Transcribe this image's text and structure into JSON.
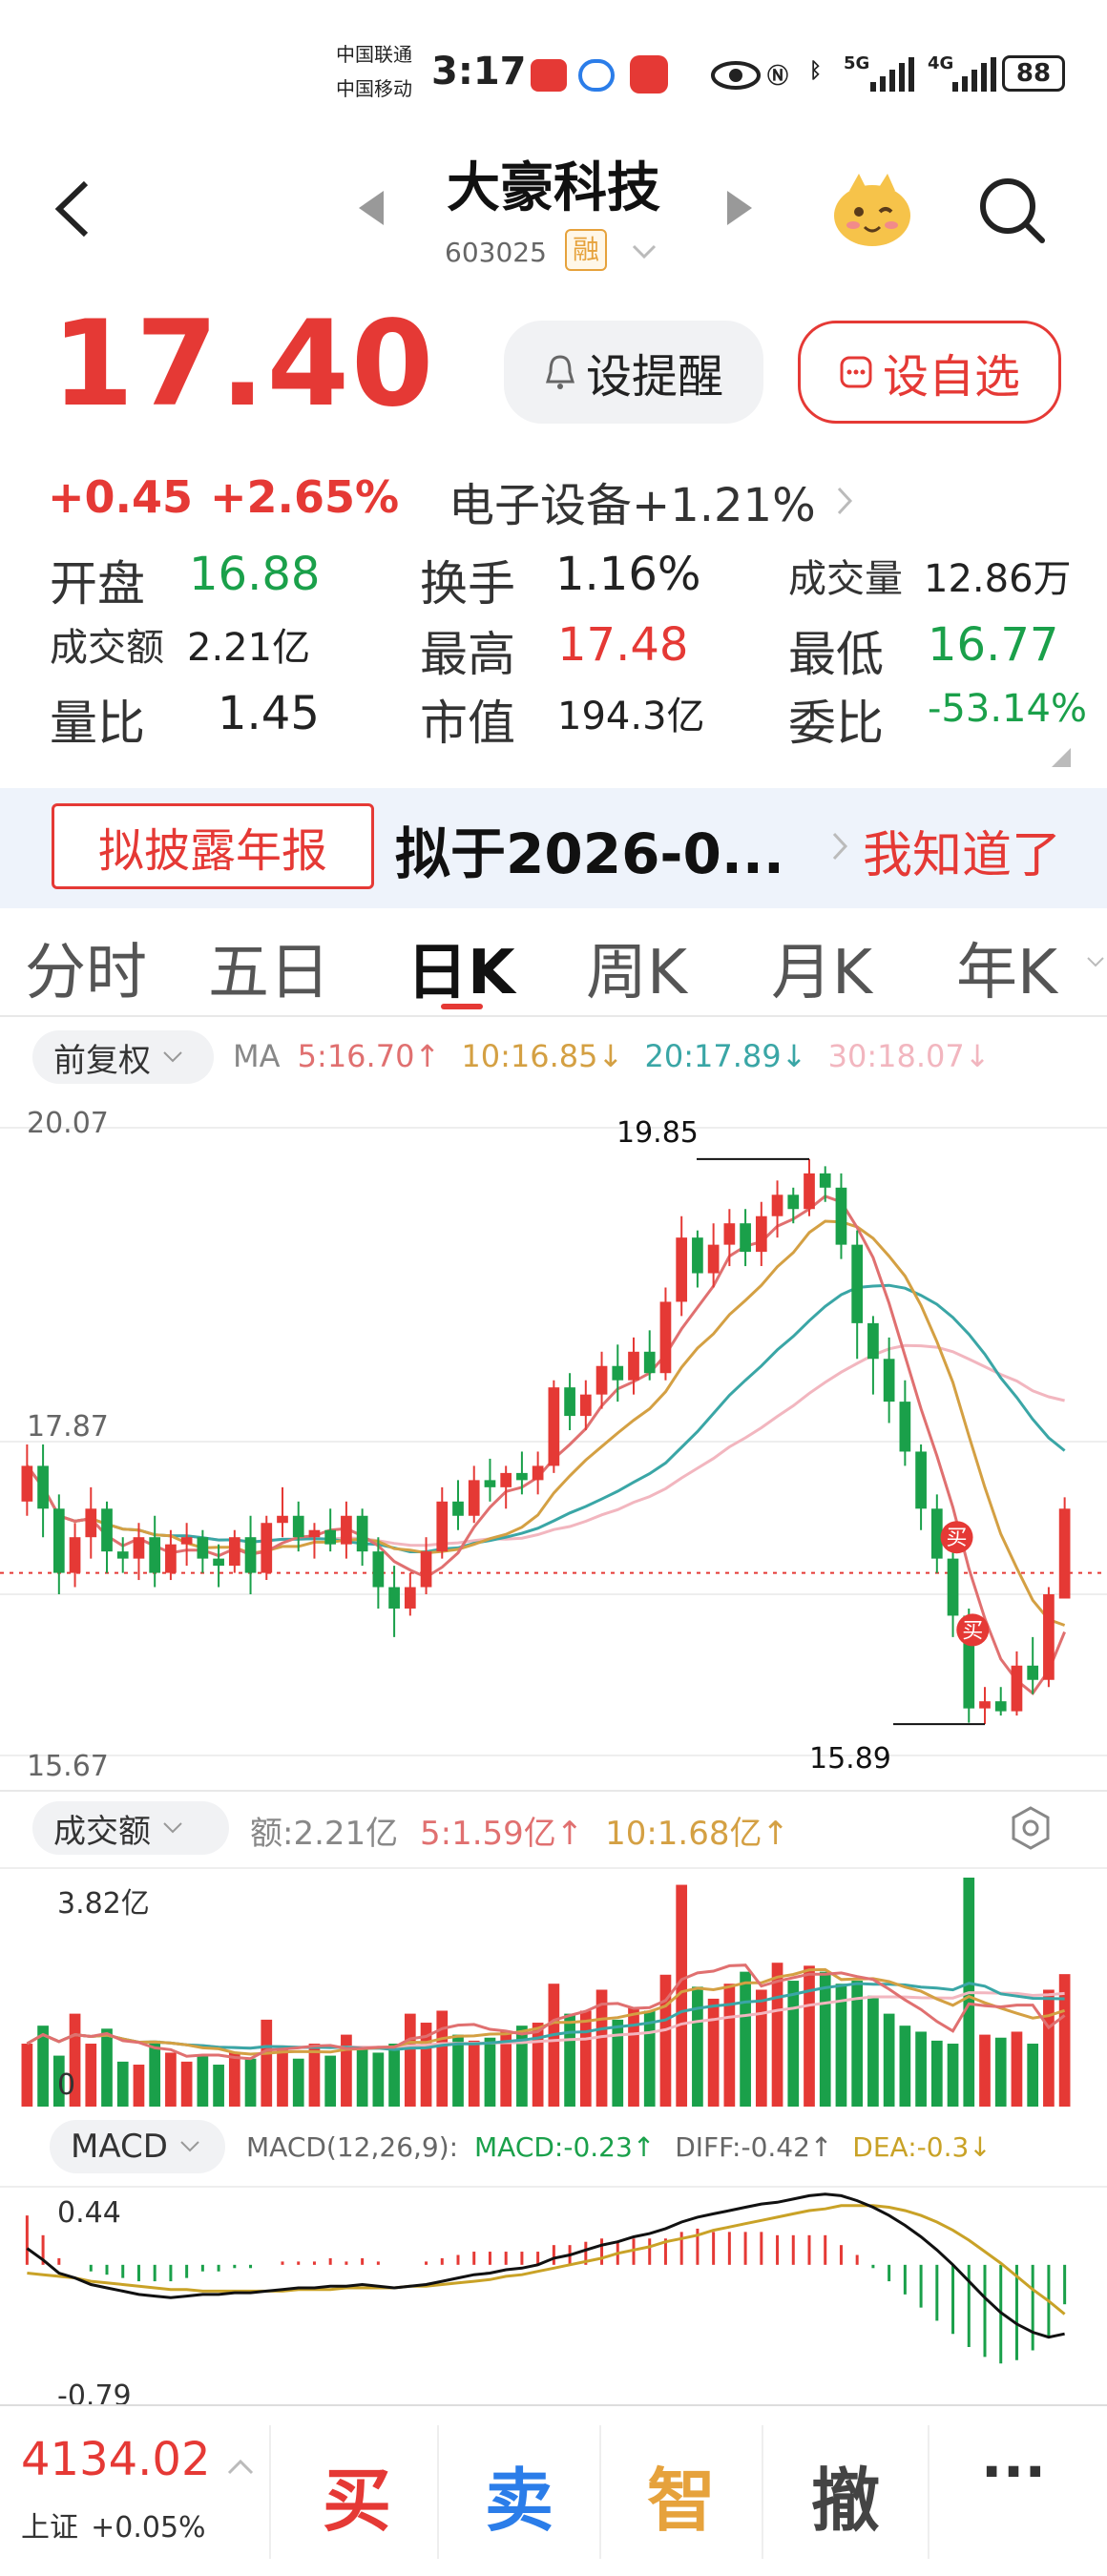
{
  "status_bar": {
    "carrier1": "中国联通",
    "carrier2": "中国移动",
    "time": "3:17",
    "network1": "5G",
    "network2": "4G",
    "battery": "88"
  },
  "header": {
    "stock_name": "大豪科技",
    "stock_code": "603025",
    "margin_tag": "融"
  },
  "quote": {
    "price": "17.40",
    "change": "+0.45",
    "change_pct": "+2.65%",
    "sector": "电子设备+1.21%",
    "alert_button": "设提醒",
    "watchlist_button": "设自选",
    "fields": {
      "open_label": "开盘",
      "open_value": "16.88",
      "turnover_label": "换手",
      "turnover_value": "1.16%",
      "volume_label": "成交量",
      "volume_value": "12.86万",
      "amount_label": "成交额",
      "amount_value": "2.21亿",
      "high_label": "最高",
      "high_value": "17.48",
      "low_label": "最低",
      "low_value": "16.77",
      "vol_ratio_label": "量比",
      "vol_ratio_value": "1.45",
      "mktcap_label": "市值",
      "mktcap_value": "194.3亿",
      "commit_label": "委比",
      "commit_value": "-53.14%"
    }
  },
  "notice": {
    "tag": "拟披露年报",
    "text": "拟于2026-0...",
    "button": "我知道了"
  },
  "tabs": [
    "分时",
    "五日",
    "日K",
    "周K",
    "月K",
    "年K"
  ],
  "kline": {
    "adjust_chip": "前复权",
    "ma_label": "MA",
    "ma5": "5:16.70↑",
    "ma10": "10:16.85↓",
    "ma20": "20:17.89↓",
    "ma30": "30:18.07↓",
    "y_top": "20.07",
    "y_mid": "17.87",
    "y_bottom": "15.67",
    "high_annot": "19.85",
    "low_annot": "15.89",
    "buy_mark": "买"
  },
  "volume": {
    "chip": "成交额",
    "amount": "额:2.21亿",
    "ma5": "5:1.59亿↑",
    "ma10": "10:1.68亿↑",
    "y_top": "3.82亿",
    "y_zero": "0"
  },
  "macd": {
    "chip": "MACD",
    "params": "MACD(12,26,9):",
    "macd": "MACD:-0.23↑",
    "diff": "DIFF:-0.42↑",
    "dea": "DEA:-0.3↓",
    "y_top": "0.44",
    "y_bottom": "-0.79"
  },
  "bottom": {
    "index_value": "4134.02",
    "index_name": "上证",
    "index_change": "+0.05%",
    "buy": "买",
    "sell": "卖",
    "smart": "智",
    "cancel": "撤",
    "more": "···"
  },
  "colors": {
    "up": "#e53935",
    "down": "#1aa04a",
    "ma5": "#e07070",
    "ma10": "#d4a043",
    "ma20": "#3aa6a6",
    "ma30": "#f2b6bf",
    "diff": "#111111",
    "dea": "#c9a227"
  },
  "chart_data": {
    "type": "candlestick",
    "y_range": [
      15.67,
      20.07
    ],
    "candles": [
      [
        17.45,
        17.85,
        17.35,
        17.7
      ],
      [
        17.7,
        17.85,
        17.2,
        17.4
      ],
      [
        17.4,
        17.5,
        16.8,
        16.95
      ],
      [
        16.95,
        17.3,
        16.85,
        17.2
      ],
      [
        17.2,
        17.55,
        17.05,
        17.4
      ],
      [
        17.4,
        17.45,
        16.95,
        17.1
      ],
      [
        17.1,
        17.2,
        16.95,
        17.05
      ],
      [
        17.05,
        17.3,
        16.9,
        17.2
      ],
      [
        17.2,
        17.35,
        16.85,
        16.95
      ],
      [
        16.95,
        17.25,
        16.9,
        17.15
      ],
      [
        17.15,
        17.3,
        17.0,
        17.2
      ],
      [
        17.2,
        17.25,
        16.95,
        17.05
      ],
      [
        17.05,
        17.15,
        16.85,
        17.0
      ],
      [
        17.0,
        17.25,
        16.95,
        17.2
      ],
      [
        17.2,
        17.35,
        16.8,
        16.95
      ],
      [
        16.95,
        17.35,
        16.9,
        17.3
      ],
      [
        17.3,
        17.55,
        17.2,
        17.35
      ],
      [
        17.35,
        17.45,
        17.1,
        17.2
      ],
      [
        17.2,
        17.3,
        17.05,
        17.25
      ],
      [
        17.25,
        17.4,
        17.1,
        17.15
      ],
      [
        17.15,
        17.45,
        17.05,
        17.35
      ],
      [
        17.35,
        17.4,
        17.0,
        17.1
      ],
      [
        17.1,
        17.2,
        16.7,
        16.85
      ],
      [
        16.85,
        17.0,
        16.5,
        16.7
      ],
      [
        16.7,
        16.95,
        16.65,
        16.85
      ],
      [
        16.85,
        17.2,
        16.8,
        17.1
      ],
      [
        17.1,
        17.55,
        17.05,
        17.45
      ],
      [
        17.45,
        17.6,
        17.25,
        17.35
      ],
      [
        17.35,
        17.7,
        17.3,
        17.6
      ],
      [
        17.6,
        17.75,
        17.45,
        17.55
      ],
      [
        17.55,
        17.7,
        17.4,
        17.65
      ],
      [
        17.65,
        17.8,
        17.5,
        17.6
      ],
      [
        17.6,
        17.8,
        17.5,
        17.7
      ],
      [
        17.7,
        18.3,
        17.65,
        18.25
      ],
      [
        18.25,
        18.35,
        17.95,
        18.05
      ],
      [
        18.05,
        18.3,
        17.95,
        18.2
      ],
      [
        18.2,
        18.5,
        18.1,
        18.4
      ],
      [
        18.4,
        18.55,
        18.15,
        18.3
      ],
      [
        18.3,
        18.6,
        18.2,
        18.5
      ],
      [
        18.5,
        18.65,
        18.3,
        18.35
      ],
      [
        18.35,
        18.95,
        18.3,
        18.85
      ],
      [
        18.85,
        19.45,
        18.75,
        19.3
      ],
      [
        19.3,
        19.35,
        18.95,
        19.05
      ],
      [
        19.05,
        19.4,
        18.95,
        19.25
      ],
      [
        19.25,
        19.5,
        19.1,
        19.4
      ],
      [
        19.4,
        19.5,
        19.1,
        19.2
      ],
      [
        19.2,
        19.55,
        19.1,
        19.45
      ],
      [
        19.45,
        19.7,
        19.3,
        19.6
      ],
      [
        19.6,
        19.65,
        19.4,
        19.5
      ],
      [
        19.5,
        19.85,
        19.45,
        19.75
      ],
      [
        19.75,
        19.8,
        19.55,
        19.65
      ],
      [
        19.65,
        19.75,
        19.15,
        19.25
      ],
      [
        19.25,
        19.35,
        18.45,
        18.7
      ],
      [
        18.7,
        18.75,
        18.2,
        18.45
      ],
      [
        18.45,
        18.6,
        18.0,
        18.15
      ],
      [
        18.15,
        18.3,
        17.7,
        17.8
      ],
      [
        17.8,
        17.85,
        17.25,
        17.4
      ],
      [
        17.4,
        17.5,
        16.95,
        17.05
      ],
      [
        17.05,
        17.15,
        16.5,
        16.65
      ],
      [
        16.65,
        16.7,
        15.9,
        16.0
      ],
      [
        16.0,
        16.15,
        15.89,
        16.05
      ],
      [
        16.05,
        16.15,
        15.95,
        15.98
      ],
      [
        15.98,
        16.4,
        15.95,
        16.3
      ],
      [
        16.3,
        16.5,
        16.1,
        16.2
      ],
      [
        16.2,
        16.85,
        16.15,
        16.8
      ],
      [
        16.77,
        17.48,
        16.77,
        17.4
      ]
    ],
    "volume_max": 3.82,
    "volume": [
      1.05,
      1.35,
      0.85,
      1.55,
      1.05,
      1.3,
      0.75,
      0.7,
      1.1,
      0.9,
      0.75,
      0.85,
      0.7,
      0.9,
      0.8,
      1.45,
      0.95,
      0.8,
      1.05,
      0.85,
      1.2,
      0.95,
      0.9,
      1.05,
      1.55,
      1.4,
      1.6,
      1.2,
      1.1,
      1.15,
      1.25,
      1.35,
      1.4,
      2.05,
      1.55,
      1.6,
      1.95,
      1.45,
      1.65,
      1.6,
      2.2,
      3.7,
      2.0,
      1.8,
      2.05,
      2.25,
      1.95,
      2.4,
      2.1,
      2.35,
      2.25,
      2.05,
      2.1,
      1.85,
      1.55,
      1.35,
      1.25,
      1.1,
      1.05,
      3.82,
      1.2,
      1.15,
      1.25,
      1.05,
      1.95,
      2.21
    ],
    "macd_range": [
      -0.79,
      0.44
    ],
    "diff": [
      0.1,
      0.03,
      -0.05,
      -0.08,
      -0.12,
      -0.14,
      -0.16,
      -0.18,
      -0.19,
      -0.2,
      -0.19,
      -0.18,
      -0.18,
      -0.17,
      -0.17,
      -0.16,
      -0.15,
      -0.14,
      -0.14,
      -0.13,
      -0.13,
      -0.12,
      -0.13,
      -0.14,
      -0.13,
      -0.12,
      -0.1,
      -0.08,
      -0.06,
      -0.05,
      -0.03,
      -0.02,
      0.0,
      0.04,
      0.06,
      0.09,
      0.12,
      0.14,
      0.17,
      0.19,
      0.22,
      0.26,
      0.29,
      0.31,
      0.33,
      0.35,
      0.37,
      0.38,
      0.4,
      0.42,
      0.43,
      0.42,
      0.39,
      0.35,
      0.3,
      0.24,
      0.17,
      0.09,
      0.0,
      -0.1,
      -0.2,
      -0.29,
      -0.36,
      -0.41,
      -0.44,
      -0.42
    ],
    "dea": [
      -0.05,
      -0.06,
      -0.07,
      -0.08,
      -0.1,
      -0.11,
      -0.12,
      -0.13,
      -0.14,
      -0.15,
      -0.15,
      -0.16,
      -0.16,
      -0.16,
      -0.16,
      -0.16,
      -0.16,
      -0.15,
      -0.15,
      -0.15,
      -0.14,
      -0.14,
      -0.14,
      -0.14,
      -0.13,
      -0.13,
      -0.12,
      -0.11,
      -0.1,
      -0.09,
      -0.07,
      -0.06,
      -0.04,
      -0.02,
      0.0,
      0.02,
      0.04,
      0.07,
      0.09,
      0.11,
      0.14,
      0.16,
      0.18,
      0.21,
      0.23,
      0.25,
      0.27,
      0.29,
      0.31,
      0.33,
      0.34,
      0.36,
      0.36,
      0.36,
      0.35,
      0.33,
      0.3,
      0.26,
      0.21,
      0.15,
      0.08,
      0.01,
      -0.07,
      -0.15,
      -0.22,
      -0.3
    ]
  }
}
